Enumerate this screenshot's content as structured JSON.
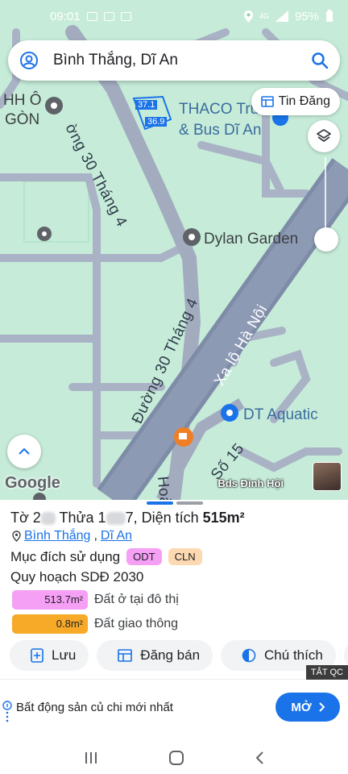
{
  "status_bar": {
    "time": "09:01",
    "battery": "95%",
    "network": "4G"
  },
  "search": {
    "value": "Bình Thắng, Dĩ An"
  },
  "map": {
    "tin_dang_label": "Tin Đăng",
    "labels": {
      "thaco_line1": "THACO Truck",
      "thaco_line2": "& Bus Dĩ An",
      "hho_line1": "HH Ô",
      "hho_line2": "GÒN",
      "dylan": "Dylan Garden",
      "dt_aquatic": "DT Aquatic",
      "road_30_thang_4_top": "ờng 30 Tháng 4",
      "road_30_thang_4_mid": "Đường 30 Tháng 4",
      "road_xa_lo": "Xa lộ Hà Nội",
      "road_so15": "Số 15",
      "road_hoa": "Hoà",
      "plot_a": "37.1",
      "plot_b": "36.9"
    },
    "google_logo": "Google",
    "bds_label": "Bds Đình Hội"
  },
  "sheet": {
    "title_prefix": "Tờ 2",
    "title_mid": " Thửa 1",
    "title_suffix": "7, Diện tích ",
    "area_value": "515m²",
    "addr_ward": "Bình Thắng",
    "addr_sep": ",",
    "addr_city": "Dĩ An",
    "purpose_label": "Mục đích sử dụng",
    "badges": [
      {
        "text": "ODT",
        "color": "#f59ff5"
      },
      {
        "text": "CLN",
        "color": "#fcd9b0"
      }
    ],
    "plan_title": "Quy hoạch SDĐ 2030",
    "plan_rows": [
      {
        "value": "513.7m²",
        "label": "Đất ở tại đô thị",
        "color": "#f59ff5"
      },
      {
        "value": "0.8m²",
        "label": "Đất giao thông",
        "color": "#f7a928"
      }
    ],
    "actions": {
      "save": "Lưu",
      "post_sale": "Đăng bán",
      "legend": "Chú thích"
    },
    "tat_qc": "TẮT QC"
  },
  "ad": {
    "text": "Bất động sản củ chi mới nhất",
    "button": "MỞ"
  },
  "colors": {
    "accent": "#1a73e8",
    "map_green": "#c6ecd9",
    "road": "#9aa3b8"
  }
}
